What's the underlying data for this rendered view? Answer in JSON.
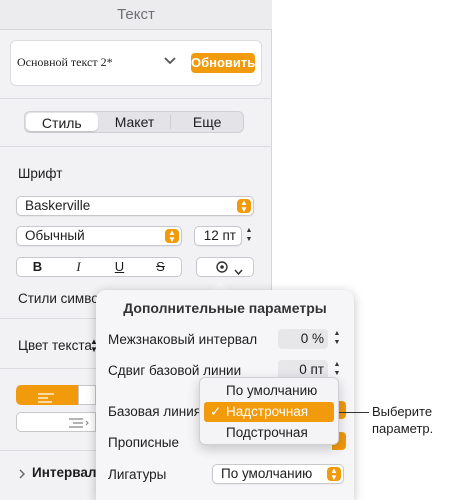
{
  "panel": {
    "title": "Текст",
    "style_name": "Основной текст 2*",
    "update_button": "Обновить",
    "tabs": [
      "Стиль",
      "Макет",
      "Еще"
    ],
    "font_section": "Шрифт",
    "font_family": "Baskerville",
    "typeface": "Обычный",
    "font_size": "12 пт",
    "format_buttons": [
      "B",
      "I",
      "U",
      "S"
    ],
    "char_styles_label": "Стили символ",
    "text_color_label": "Цвет текста",
    "spacing_label": "Интервал"
  },
  "popover": {
    "title": "Дополнительные параметры",
    "char_spacing_label": "Межзнаковый интервал",
    "char_spacing_value": "0 %",
    "baseline_shift_label": "Сдвиг базовой линии",
    "baseline_shift_value": "0 пт",
    "baseline_label": "Базовая линия",
    "capitalization_label": "Прописные",
    "ligatures_label": "Лигатуры",
    "ligatures_value": "По умолчанию"
  },
  "menu": {
    "items": [
      "По умолчанию",
      "Надстрочная",
      "Подстрочная"
    ],
    "selected_index": 1
  },
  "callout": "Выберите параметр.",
  "colors": {
    "accent": "#f19a0c",
    "panel_bg": "#f2f2f4"
  }
}
